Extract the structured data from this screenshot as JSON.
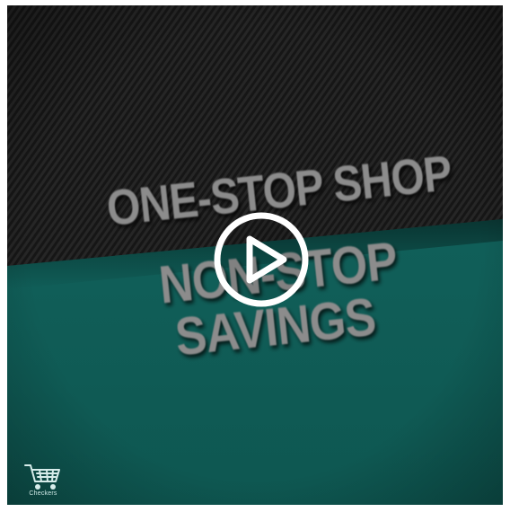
{
  "video": {
    "headline_line1": "ONE-STOP SHOP",
    "headline_line2": "NON-STOP",
    "headline_line3": "SAVINGS",
    "play_icon": "play-circle-icon",
    "logo_icon": "shopping-cart-icon",
    "logo_text": "Checkers"
  },
  "colors": {
    "top_background": "#1a1a1a",
    "bottom_background": "#0f5a55",
    "headline_text": "#8c8c8c",
    "play_icon": "#ffffff"
  }
}
